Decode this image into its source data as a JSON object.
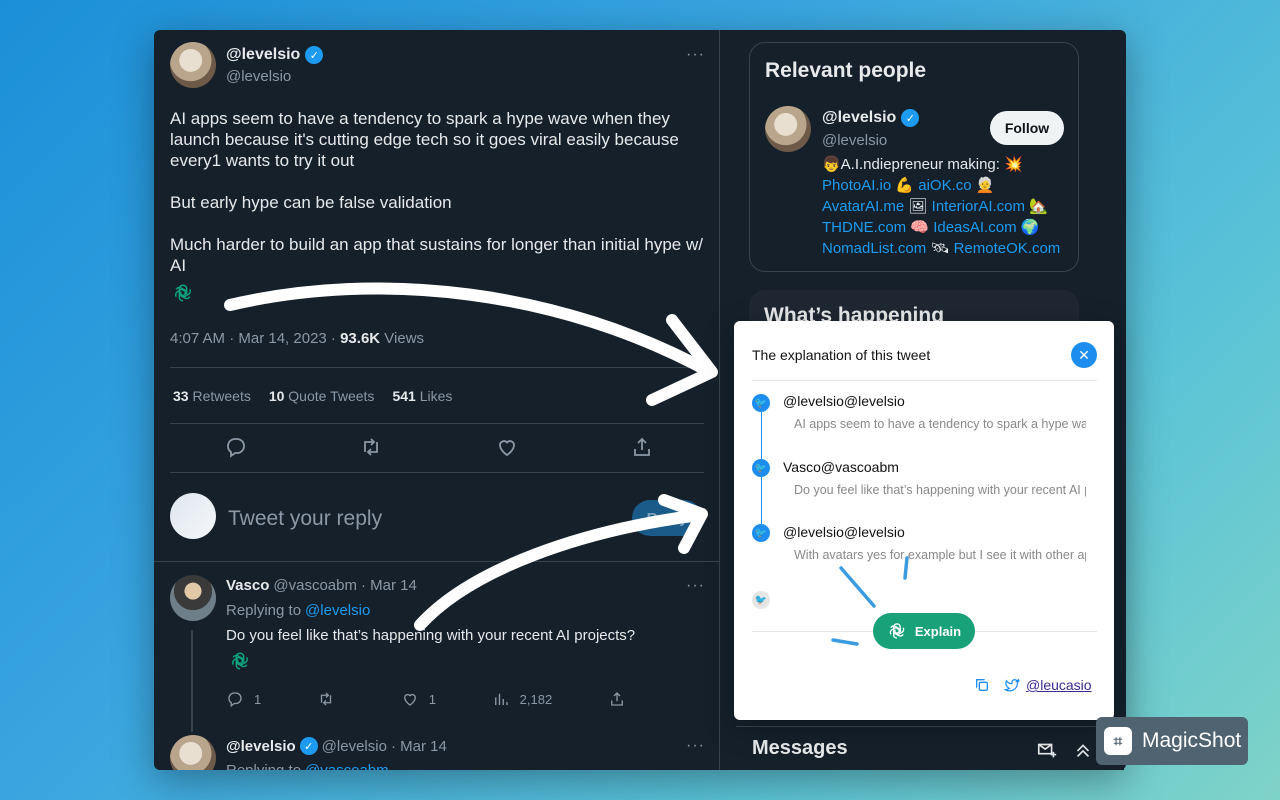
{
  "tweet": {
    "display_name": "@levelsio",
    "handle": "@levelsio",
    "more": "···",
    "text": [
      "AI apps seem to have a tendency to spark a hype wave when they launch because it's cutting edge tech so it goes viral easily because every1 wants to try it out",
      "But early hype can be false validation",
      "Much harder to build an app that sustains for longer than initial hype w/ AI"
    ],
    "time": "4:07 AM · Mar 14, 2023 ·",
    "views_count": "93.6K",
    "views_label": "Views",
    "retweets_count": "33",
    "retweets_label": "Retweets",
    "quotes_count": "10",
    "quotes_label": "Quote Tweets",
    "likes_count": "541",
    "likes_label": "Likes"
  },
  "reply_box": {
    "placeholder": "Tweet your reply",
    "button": "Reply"
  },
  "replies": [
    {
      "name": "Vasco",
      "handle": "@vascoabm",
      "date": "· Mar 14",
      "replying_label": "Replying to",
      "replying_to": "@levelsio",
      "text": "Do you feel like that’s happening with your recent AI projects?",
      "replies": "1",
      "retweets": "",
      "likes": "1",
      "views": "2,182"
    },
    {
      "name": "@levelsio",
      "handle": "@levelsio",
      "date": "· Mar 14",
      "replying_label": "Replying to",
      "replying_to": "@vascoabm"
    }
  ],
  "relevant": {
    "title": "Relevant people",
    "name": "@levelsio",
    "handle": "@levelsio",
    "follow": "Follow",
    "bio": [
      {
        "text": "👦A.I.ndiepreneur making: 💥",
        "link": false
      },
      {
        "text": "PhotoAI.io",
        "link": true
      },
      {
        "text": " 💪 ",
        "link": false
      },
      {
        "text": "aiOK.co",
        "link": true
      },
      {
        "text": " 🧑‍🦳",
        "link": false
      },
      {
        "text": "AvatarAI.me",
        "link": true
      },
      {
        "text": " 🖼 ",
        "link": false
      },
      {
        "text": "InteriorAI.com",
        "link": true
      },
      {
        "text": " 🏡",
        "link": false
      },
      {
        "text": "THDNE.com",
        "link": true
      },
      {
        "text": " 🧠 ",
        "link": false
      },
      {
        "text": "IdeasAI.com",
        "link": true
      },
      {
        "text": " 🌍",
        "link": false
      },
      {
        "text": "NomadList.com",
        "link": true
      },
      {
        "text": " 🛰 ",
        "link": false
      },
      {
        "text": "RemoteOK.com",
        "link": true
      }
    ]
  },
  "happening": {
    "title": "What’s happening"
  },
  "messages": {
    "title": "Messages"
  },
  "popup": {
    "title": "The explanation of this tweet",
    "items": [
      {
        "name": "@levelsio@levelsio",
        "text": "AI apps seem to have a tendency to spark a hype wave when they launch because it's cutting edge tech"
      },
      {
        "name": "Vasco@vascoabm",
        "text": "Do you feel like that’s happening with your recent AI projects?"
      },
      {
        "name": "@levelsio@levelsio",
        "text": "With avatars yes for example but I see it with other apps too"
      }
    ],
    "explain_button": "Explain",
    "author_link": "@leucasio"
  },
  "badge": {
    "label": "MagicShot"
  },
  "colors": {
    "twitter_bg": "#15202b",
    "accent": "#1d9bf0",
    "explain_green": "#19a27a"
  }
}
